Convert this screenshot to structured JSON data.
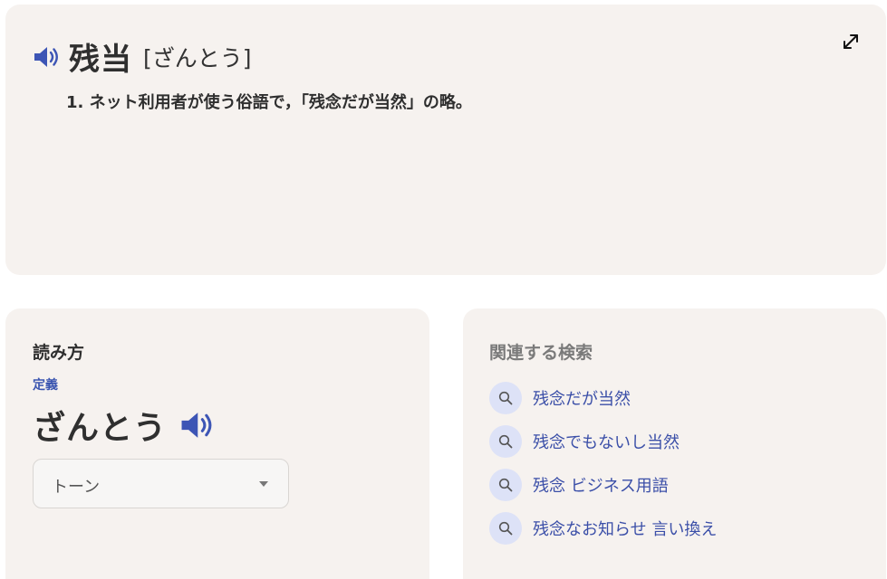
{
  "entry": {
    "headword": "残当",
    "reading_bracket": "[ざんとう]",
    "definition": "1. ネット利用者が使う俗語で，「残念だが当然」の略。"
  },
  "reading_section": {
    "title": "読み方",
    "definition_label": "定義",
    "reading": "ざんとう",
    "tone_select": {
      "selected": "トーン"
    }
  },
  "related": {
    "title": "関連する検索",
    "items": [
      {
        "label": "残念だが当然"
      },
      {
        "label": "残念でもないし当然"
      },
      {
        "label": "残念 ビジネス用語"
      },
      {
        "label": "残念なお知らせ 言い換え"
      }
    ]
  },
  "icons": {
    "speaker": "speaker-icon",
    "expand": "expand-icon",
    "search": "search-icon",
    "caret": "caret-down-icon"
  },
  "colors": {
    "card_bg": "#f6f2ef",
    "accent_blue": "#3b4fa8",
    "speaker_blue": "#3d55b5",
    "search_circle": "#dde2f7"
  }
}
